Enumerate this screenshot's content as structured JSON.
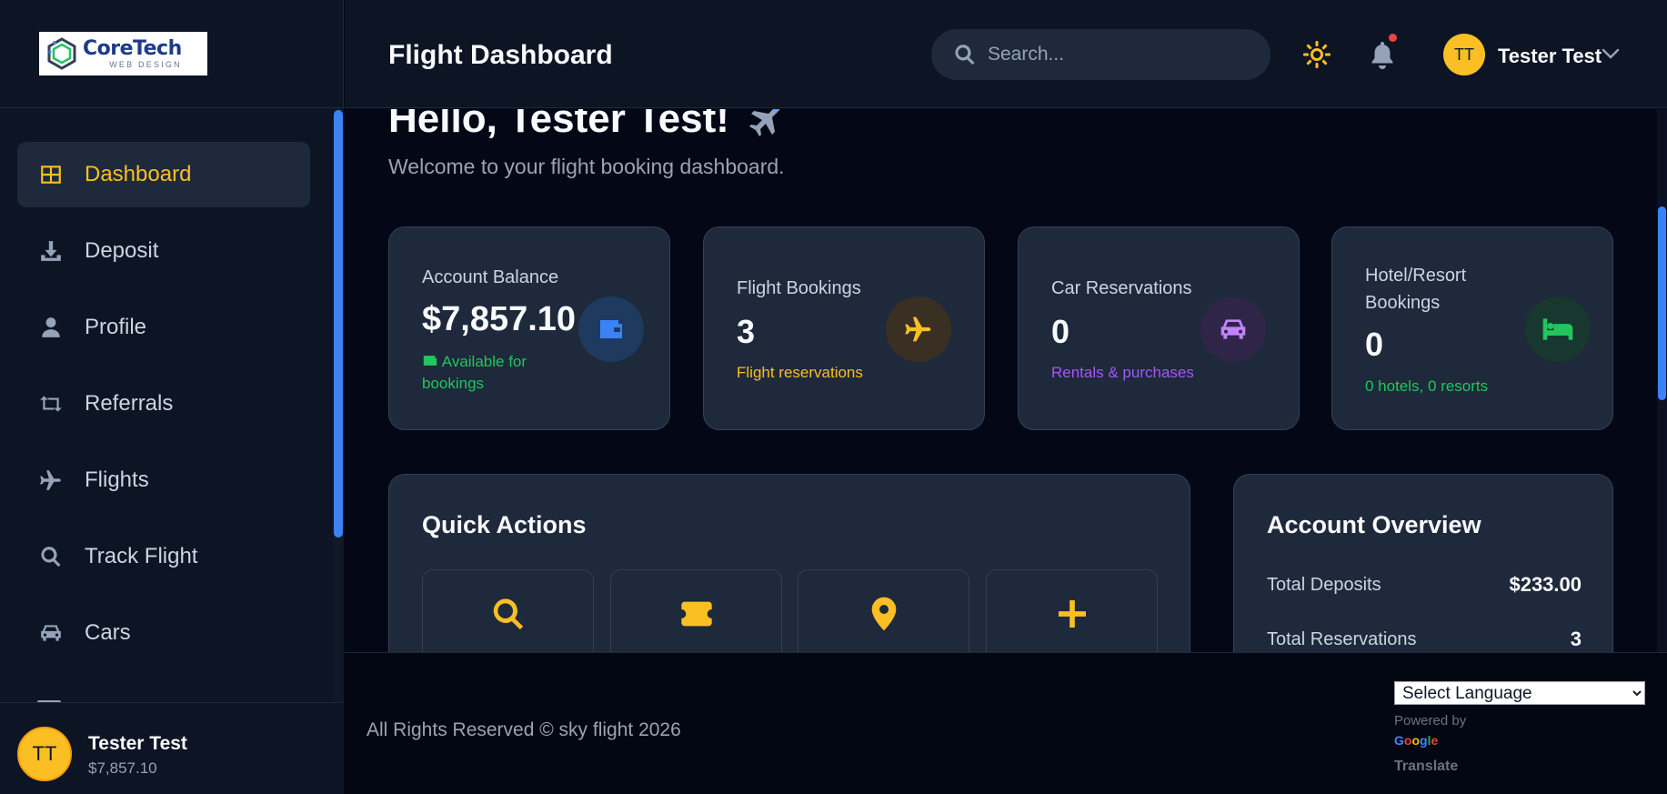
{
  "brand": {
    "name": "CoreTech",
    "tagline": "WEB DESIGN"
  },
  "sidebar": {
    "items": [
      {
        "label": "Dashboard",
        "icon": "grid-icon",
        "active": true
      },
      {
        "label": "Deposit",
        "icon": "download-icon"
      },
      {
        "label": "Profile",
        "icon": "user-icon"
      },
      {
        "label": "Referrals",
        "icon": "retweet-icon"
      },
      {
        "label": "Flights",
        "icon": "plane-icon"
      },
      {
        "label": "Track Flight",
        "icon": "search-icon"
      },
      {
        "label": "Cars",
        "icon": "car-icon"
      }
    ],
    "user": {
      "initials": "TT",
      "name": "Tester Test",
      "balance": "$7,857.10"
    }
  },
  "header": {
    "title": "Flight Dashboard",
    "search_placeholder": "Search...",
    "user": {
      "initials": "TT",
      "name": "Tester Test"
    }
  },
  "main": {
    "greeting": "Hello, Tester Test!",
    "welcome": "Welcome to your flight booking dashboard.",
    "cards": [
      {
        "label": "Account Balance",
        "value": "$7,857.10",
        "sub": "Available for bookings",
        "icon": "wallet-icon",
        "accent": "#3b82f6"
      },
      {
        "label": "Flight Bookings",
        "value": "3",
        "sub": "Flight reservations",
        "icon": "plane-icon",
        "accent": "#fbbf24"
      },
      {
        "label": "Car Reservations",
        "value": "0",
        "sub": "Rentals & purchases",
        "icon": "car-icon",
        "accent": "#a855f7"
      },
      {
        "label": "Hotel/Resort Bookings",
        "label_lines": [
          "Hotel/Resort",
          "Bookings"
        ],
        "value": "0",
        "sub": "0 hotels, 0 resorts",
        "icon": "bed-icon",
        "accent": "#22c55e"
      }
    ],
    "quick_actions": {
      "title": "Quick Actions",
      "buttons": [
        {
          "icon": "search-icon"
        },
        {
          "icon": "ticket-icon"
        },
        {
          "icon": "map-pin-icon"
        },
        {
          "icon": "plus-icon"
        }
      ]
    },
    "overview": {
      "title": "Account Overview",
      "rows": [
        {
          "label": "Total Deposits",
          "value": "$233.00"
        },
        {
          "label": "Total Reservations",
          "value": "3"
        }
      ]
    }
  },
  "footer": {
    "copyright": "All Rights Reserved © sky flight 2026",
    "language_select": "Select Language",
    "powered_by": "Powered by",
    "google": "Google",
    "translate": "Translate"
  },
  "colors": {
    "accent": "#fbbf24",
    "background": "#040816",
    "panel": "#1e293b",
    "scroll": "#3b82f6"
  }
}
